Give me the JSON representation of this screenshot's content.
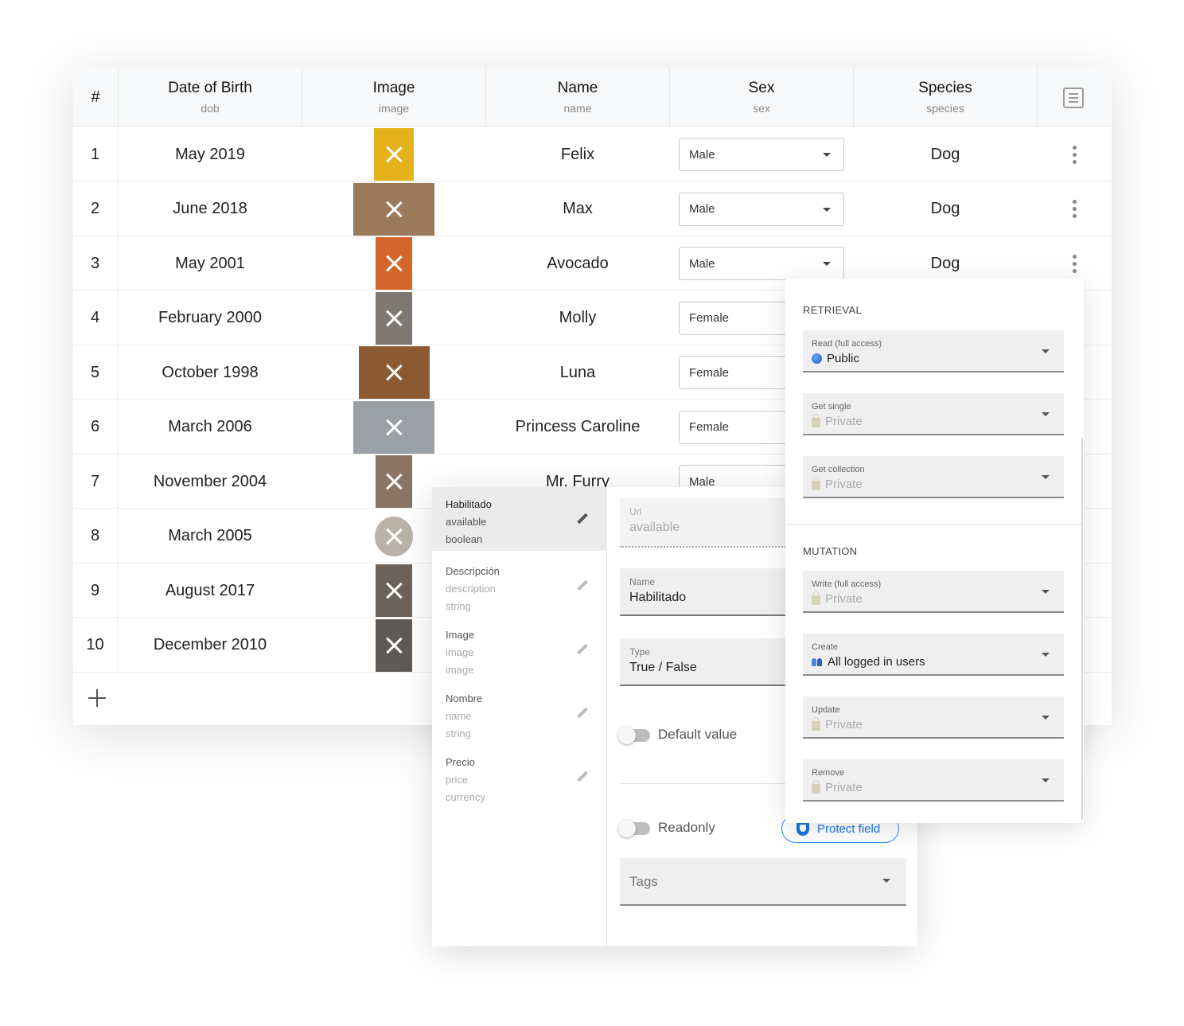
{
  "table": {
    "headers": [
      {
        "title": "#",
        "key": ""
      },
      {
        "title": "Date of Birth",
        "key": "dob"
      },
      {
        "title": "Image",
        "key": "image"
      },
      {
        "title": "Name",
        "key": "name"
      },
      {
        "title": "Sex",
        "key": "sex"
      },
      {
        "title": "Species",
        "key": "species"
      }
    ],
    "rows": [
      {
        "index": "1",
        "dob": "May 2019",
        "image_color": "#e3b21a",
        "name": "Felix",
        "sex": "Male",
        "species": "Dog"
      },
      {
        "index": "2",
        "dob": "June 2018",
        "image_color": "#9a7a5a",
        "name": "Max",
        "sex": "Male",
        "species": "Dog"
      },
      {
        "index": "3",
        "dob": "May 2001",
        "image_color": "#d4652b",
        "name": "Avocado",
        "sex": "Male",
        "species": "Dog"
      },
      {
        "index": "4",
        "dob": "February 2000",
        "image_color": "#7e7a73",
        "name": "Molly",
        "sex": "Female",
        "species": ""
      },
      {
        "index": "5",
        "dob": "October 1998",
        "image_color": "#8c5a32",
        "name": "Luna",
        "sex": "Female",
        "species": ""
      },
      {
        "index": "6",
        "dob": "March 2006",
        "image_color": "#9aa0a6",
        "name": "Princess Caroline",
        "sex": "Female",
        "species": ""
      },
      {
        "index": "7",
        "dob": "November 2004",
        "image_color": "#8a7565",
        "name": "Mr. Furry",
        "sex": "Male",
        "species": ""
      },
      {
        "index": "8",
        "dob": "March 2005",
        "image_color": "#b9b2a6",
        "name": "",
        "sex": "",
        "species": ""
      },
      {
        "index": "9",
        "dob": "August 2017",
        "image_color": "#6d6259",
        "name": "",
        "sex": "",
        "species": ""
      },
      {
        "index": "10",
        "dob": "December 2010",
        "image_color": "#5e5a57",
        "name": "",
        "sex": "",
        "species": ""
      }
    ]
  },
  "properties": [
    {
      "title": "Habilitado",
      "key": "available",
      "type": "boolean"
    },
    {
      "title": "Descripción",
      "key": "description",
      "type": "string"
    },
    {
      "title": "Image",
      "key": "image",
      "type": "image"
    },
    {
      "title": "Nombre",
      "key": "name",
      "type": "string"
    },
    {
      "title": "Precio",
      "key": "price",
      "type": "currency"
    }
  ],
  "editor": {
    "url_label": "Url",
    "url_value": "available",
    "name_label": "Name",
    "name_value": "Habilitado",
    "type_label": "Type",
    "type_value": "True / False",
    "default_value_label": "Default value",
    "readonly_label": "Readonly",
    "protect_label": "Protect field",
    "tags_placeholder": "Tags"
  },
  "permissions": {
    "retrieval_title": "RETRIEVAL",
    "mutation_title": "MUTATION",
    "retrieval": [
      {
        "label": "Read (full access)",
        "value": "Public",
        "icon": "globe-icon"
      },
      {
        "label": "Get single",
        "value": "Private",
        "icon": "lock-icon"
      },
      {
        "label": "Get collection",
        "value": "Private",
        "icon": "lock-icon"
      }
    ],
    "mutation": [
      {
        "label": "Write (full access)",
        "value": "Private",
        "icon": "lock-icon"
      },
      {
        "label": "Create",
        "value": "All logged in users",
        "icon": "users-icon"
      },
      {
        "label": "Update",
        "value": "Private",
        "icon": "lock-icon"
      },
      {
        "label": "Remove",
        "value": "Private",
        "icon": "lock-icon"
      }
    ]
  }
}
